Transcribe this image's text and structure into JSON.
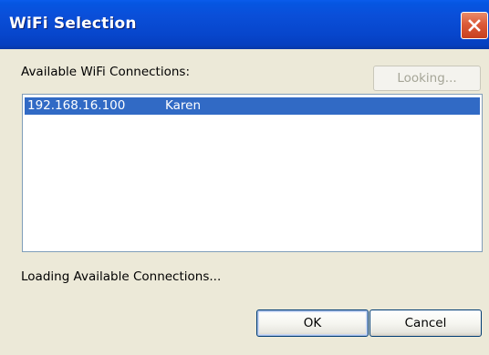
{
  "window": {
    "title": "WiFi Selection",
    "close_icon": "close-icon"
  },
  "main": {
    "available_label": "Available WiFi Connections:",
    "looking_button_label": "Looking...",
    "connections": [
      {
        "ip": "192.168.16.100",
        "name": "Karen",
        "selected": true
      }
    ],
    "status_text": "Loading Available Connections..."
  },
  "buttons": {
    "ok_label": "OK",
    "cancel_label": "Cancel"
  },
  "colors": {
    "titlebar": "#0A4FD9",
    "selection": "#316AC5",
    "close_button": "#DB5A38",
    "dialog_background": "#ECE9D8"
  }
}
